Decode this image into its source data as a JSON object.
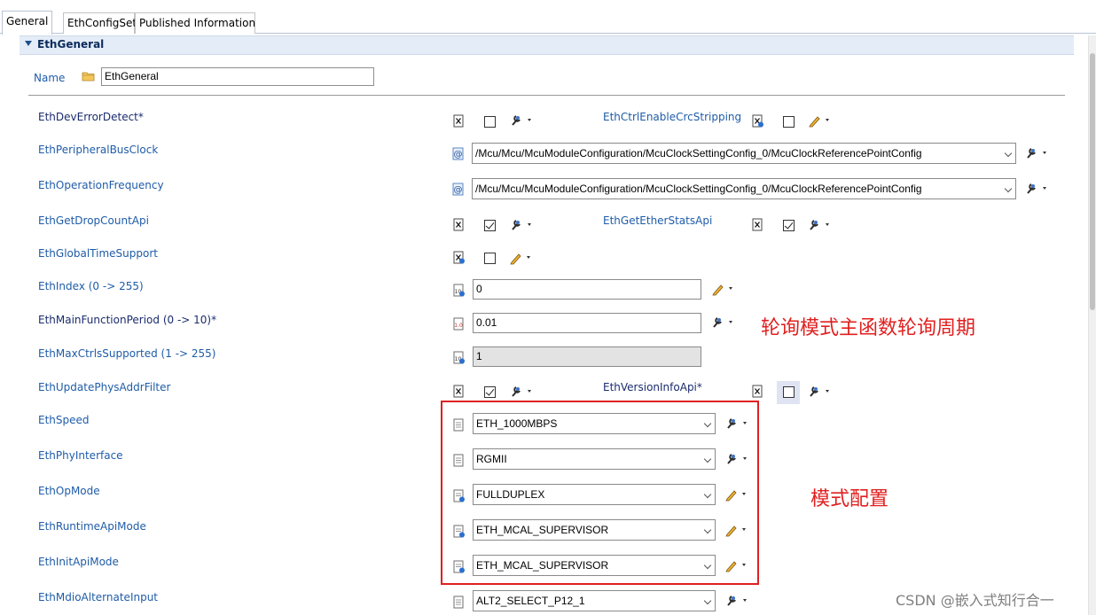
{
  "tabs": [
    "General",
    "EthConfigSet",
    "Published Information"
  ],
  "section_title": "EthGeneral",
  "name_label": "Name",
  "name_value": "EthGeneral",
  "labels": {
    "dev_error_detect": "EthDevErrorDetect*",
    "ctrl_enable_crc_stripping": "EthCtrlEnableCrcStripping",
    "peripheral_bus_clock": "EthPeripheralBusClock",
    "operation_frequency": "EthOperationFrequency",
    "get_drop_count_api": "EthGetDropCountApi",
    "get_ether_stats_api": "EthGetEtherStatsApi",
    "global_time_support": "EthGlobalTimeSupport",
    "index": "EthIndex (0 -> 255)",
    "main_function_period": "EthMainFunctionPeriod (0 -> 10)*",
    "max_ctrls_supported": "EthMaxCtrlsSupported (1 -> 255)",
    "update_phys_addr_filter": "EthUpdatePhysAddrFilter",
    "version_info_api": "EthVersionInfoApi*",
    "speed": "EthSpeed",
    "phy_interface": "EthPhyInterface",
    "op_mode": "EthOpMode",
    "runtime_api_mode": "EthRuntimeApiMode",
    "init_api_mode": "EthInitApiMode",
    "mdio_alternate_input": "EthMdioAlternateInput"
  },
  "values": {
    "peripheral_bus_clock": "/Mcu/Mcu/McuModuleConfiguration/McuClockSettingConfig_0/McuClockReferencePointConfig",
    "operation_frequency": "/Mcu/Mcu/McuModuleConfiguration/McuClockSettingConfig_0/McuClockReferencePointConfig",
    "index": "0",
    "main_function_period": "0.01",
    "max_ctrls_supported": "1",
    "speed": "ETH_1000MBPS",
    "phy_interface": "RGMII",
    "op_mode": "FULLDUPLEX",
    "runtime_api_mode": "ETH_MCAL_SUPERVISOR",
    "init_api_mode": "ETH_MCAL_SUPERVISOR",
    "mdio_alternate_input": "ALT2_SELECT_P12_1"
  },
  "checkboxes": {
    "dev_error_detect": false,
    "ctrl_enable_crc_stripping": false,
    "get_drop_count_api": true,
    "get_ether_stats_api": true,
    "global_time_support": false,
    "update_phys_addr_filter": true,
    "version_info_api": false
  },
  "annotations": {
    "main_function_note": "轮询模式主函数轮询周期",
    "mode_config_note": "模式配置"
  },
  "watermark": "CSDN @嵌入式知行合一",
  "colors": {
    "label_blue": "#1f5ca8",
    "annotation_red": "#e02020",
    "section_bg": "#e4ecf7"
  }
}
